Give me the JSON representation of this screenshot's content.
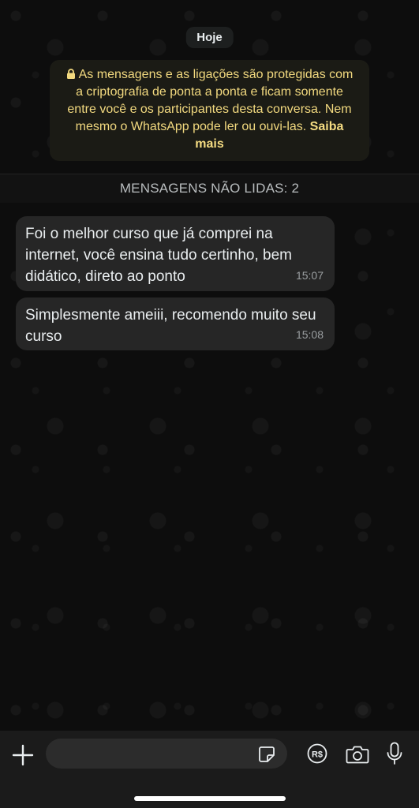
{
  "chat": {
    "date_label": "Hoje",
    "encryption_notice": {
      "text": "As mensagens e as ligações são protegidas com a criptografia de ponta a ponta e ficam somente entre você e os participantes desta conversa. Nem mesmo o WhatsApp pode ler ou ouvi-las.",
      "link_label": "Saiba mais"
    },
    "unread_divider": "MENSAGENS NÃO LIDAS: 2",
    "messages": [
      {
        "text": "Foi o melhor curso que já comprei na internet, você ensina tudo certinho, bem didático, direto ao ponto",
        "time": "15:07"
      },
      {
        "text": "Simplesmente ameiii, recomendo muito seu curso",
        "time": "15:08"
      }
    ]
  },
  "composer": {
    "input_value": "",
    "icons": [
      "plus-icon",
      "sticker-icon",
      "payment-icon",
      "camera-icon",
      "mic-icon"
    ]
  },
  "colors": {
    "notice_text": "#f2d97f",
    "bubble": "#262626",
    "background": "#0d0d0d"
  }
}
